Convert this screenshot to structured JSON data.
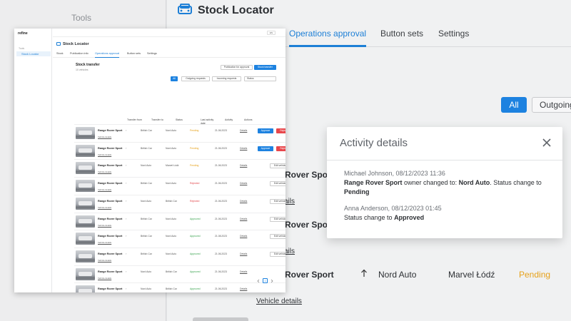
{
  "background": {
    "sidebar_label": "Tools",
    "page_title": "Stock Locator",
    "tabs": [
      {
        "label": "Operations approval",
        "active": true
      },
      {
        "label": "Button sets",
        "active": false
      },
      {
        "label": "Settings",
        "active": false
      }
    ],
    "filter_all": "All",
    "filter_outgoing": "Outgoing",
    "row_names": [
      "Rover Sport",
      "Rover Sport",
      "Rover Sport"
    ],
    "vehicle_details": [
      "ails",
      "ails",
      "Vehicle details"
    ],
    "visible_row": {
      "from": "Nord Auto",
      "to": "Marvel Łódź",
      "status": "Pending"
    }
  },
  "modal": {
    "title": "Activity details",
    "entries": [
      {
        "meta": "Michael Johnson, 08/12/2023 11:36",
        "bold1": "Range Rover Sport",
        "text1": " owner changed to: ",
        "bold2": "Nord Auto",
        "text2": ". Status change to ",
        "bold3": "Pending"
      },
      {
        "meta": "Anna Anderson, 08/12/2023 01:45",
        "text1": "Status change to ",
        "bold1": "Approved"
      }
    ]
  },
  "mini": {
    "logo": "refine",
    "sidebar_section": "Tools",
    "sidebar_item": "Stock Locator",
    "lang": "EN",
    "title": "Stock Locator",
    "tabs": [
      "Stock",
      "Publication info",
      "Operations approval",
      "Button sets",
      "Settings"
    ],
    "card_title": "Stock transfer",
    "card_sub": "10 vehicles",
    "pub_btn": "Publication for approval",
    "transfer_btn": "Stock transfer",
    "filters": [
      "All",
      "Outgoing requests",
      "Incoming requests",
      "Status"
    ],
    "headers": [
      "Transfer from",
      "Transfer to",
      "Status",
      "Last activity date",
      "Activity",
      "Actions"
    ],
    "rows": [
      {
        "name": "Range Rover Sport",
        "from": "British Car",
        "to": "Nord Auto",
        "status": "Pending",
        "date": "21.06.2023",
        "activity": "Details",
        "actions": "approve-reject"
      },
      {
        "name": "Range Rover Sport",
        "from": "British Car",
        "to": "Nord Auto",
        "status": "Pending",
        "date": "21.06.2023",
        "activity": "Details",
        "actions": "approve-reject"
      },
      {
        "name": "Range Rover Sport",
        "from": "Nord Auto",
        "to": "Marvel Łódź",
        "status": "Pending",
        "date": "21.06.2023",
        "activity": "Details",
        "actions": "edit"
      },
      {
        "name": "Range Rover Sport",
        "from": "British Car",
        "to": "Nord Auto",
        "status": "Rejected",
        "date": "21.06.2023",
        "activity": "Details",
        "actions": "edit"
      },
      {
        "name": "Range Rover Sport",
        "from": "Nord Auto",
        "to": "British Car",
        "status": "Rejected",
        "date": "21.06.2023",
        "activity": "Details",
        "actions": "edit"
      },
      {
        "name": "Range Rover Sport",
        "from": "British Car",
        "to": "Nord Auto",
        "status": "Approved",
        "date": "21.06.2023",
        "activity": "Details",
        "actions": "edit"
      },
      {
        "name": "Range Rover Sport",
        "from": "British Car",
        "to": "Nord Auto",
        "status": "Approved",
        "date": "21.08.2023",
        "activity": "Details",
        "actions": "edit"
      },
      {
        "name": "Range Rover Sport",
        "from": "British Car",
        "to": "Nord Auto",
        "status": "Approved",
        "date": "21.06.2023",
        "activity": "Details",
        "actions": "edit"
      },
      {
        "name": "Range Rover Sport",
        "from": "Nord Auto",
        "to": "British Car",
        "status": "Approved",
        "date": "21.06.2023",
        "activity": "Details",
        "actions": "none"
      },
      {
        "name": "Range Rover Sport",
        "from": "Nord Auto",
        "to": "British Car",
        "status": "Approved",
        "date": "21.06.2023",
        "activity": "Details",
        "actions": "none"
      }
    ],
    "vehicle_details": "Vehicle details",
    "approve": "Approve",
    "reject": "Reject",
    "edit": "Edit vehicle",
    "page": "1"
  }
}
